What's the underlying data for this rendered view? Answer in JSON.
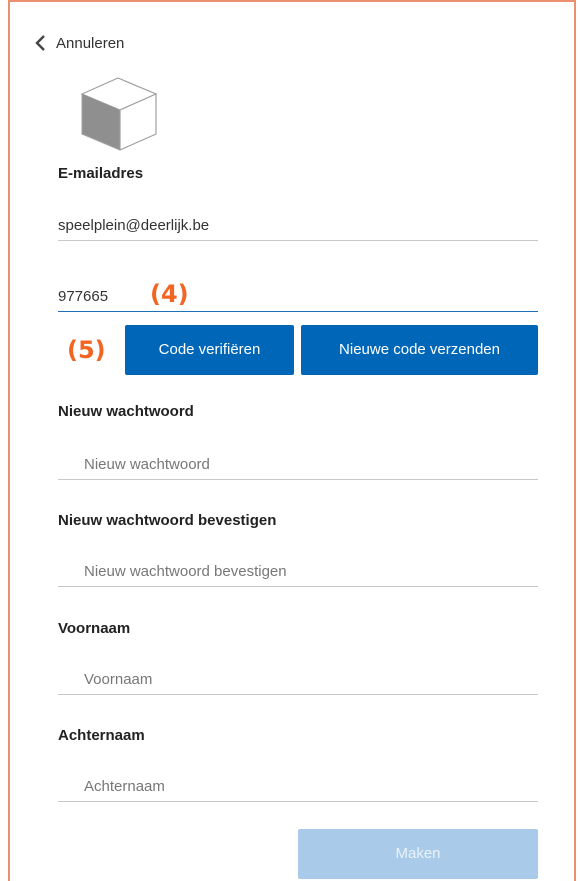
{
  "header": {
    "back_label": "Annuleren"
  },
  "email": {
    "label": "E-mailadres",
    "value": "speelplein@deerlijk.be"
  },
  "code": {
    "value": "977665"
  },
  "annotations": {
    "step4": "(4)",
    "step5": "(5)"
  },
  "buttons": {
    "verify": "Code verifiëren",
    "resend": "Nieuwe code verzenden",
    "create": "Maken"
  },
  "new_password": {
    "label": "Nieuw wachtwoord",
    "placeholder": "Nieuw wachtwoord"
  },
  "confirm_password": {
    "label": "Nieuw wachtwoord bevestigen",
    "placeholder": "Nieuw wachtwoord bevestigen"
  },
  "first_name": {
    "label": "Voornaam",
    "placeholder": "Voornaam"
  },
  "last_name": {
    "label": "Achternaam",
    "placeholder": "Achternaam"
  },
  "colors": {
    "primary": "#0067b8",
    "disabled": "#a9cbe9",
    "annotation": "#f26522",
    "frame": "#ec8f6d"
  },
  "icons": {
    "back": "chevron-left-icon",
    "logo": "cube-logo-icon"
  }
}
